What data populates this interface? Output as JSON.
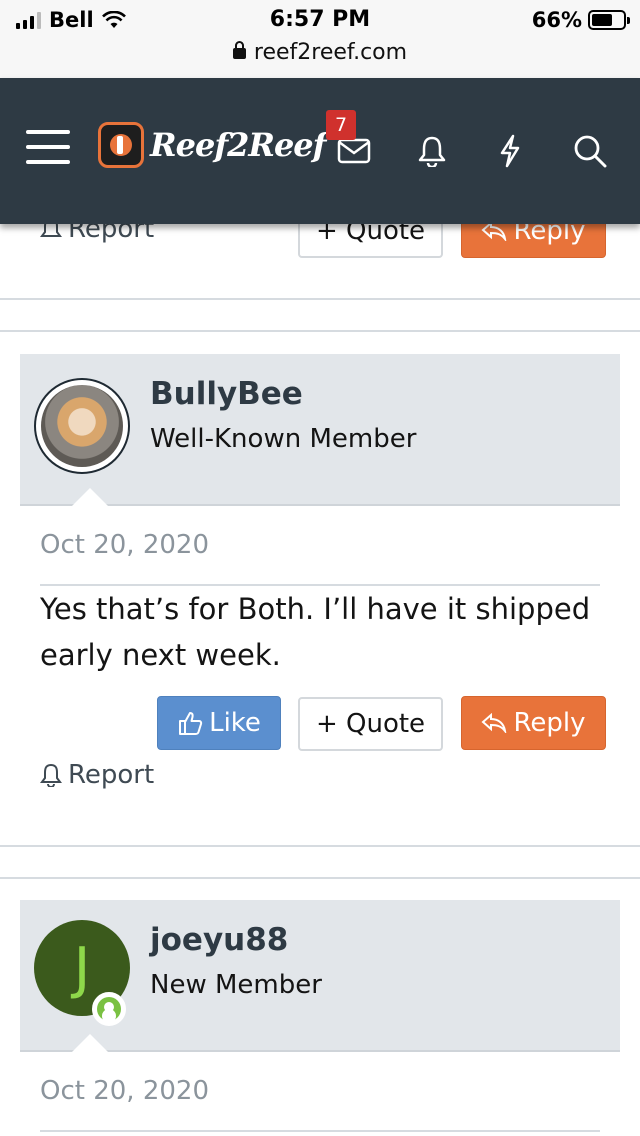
{
  "status": {
    "carrier": "Bell",
    "time": "6:57 PM",
    "battery": "66%",
    "battery_level": 0.66,
    "url": "reef2reef.com"
  },
  "header": {
    "logo_text": "Reef2Reef",
    "notification_count": "7",
    "icons": [
      "menu-icon",
      "mail-icon",
      "bell-icon",
      "lightning-icon",
      "search-icon"
    ]
  },
  "previous_post": {
    "report_label": "Report",
    "quote_label": "+ Quote",
    "reply_label": "Reply"
  },
  "posts": [
    {
      "username": "BullyBee",
      "user_title": "Well-Known Member",
      "date": "Oct 20, 2020",
      "body": "Yes that’s for Both. I’ll have it shipped early next week.",
      "like_label": "Like",
      "quote_label": "+ Quote",
      "reply_label": "Reply",
      "report_label": "Report"
    },
    {
      "username": "joeyu88",
      "avatar_letter": "J",
      "user_title": "New Member",
      "date": "Oct 20, 2020"
    }
  ],
  "colors": {
    "header_bg": "#2e3a44",
    "like": "#5b8fcf",
    "reply": "#e8733a",
    "badge": "#d0312d"
  }
}
